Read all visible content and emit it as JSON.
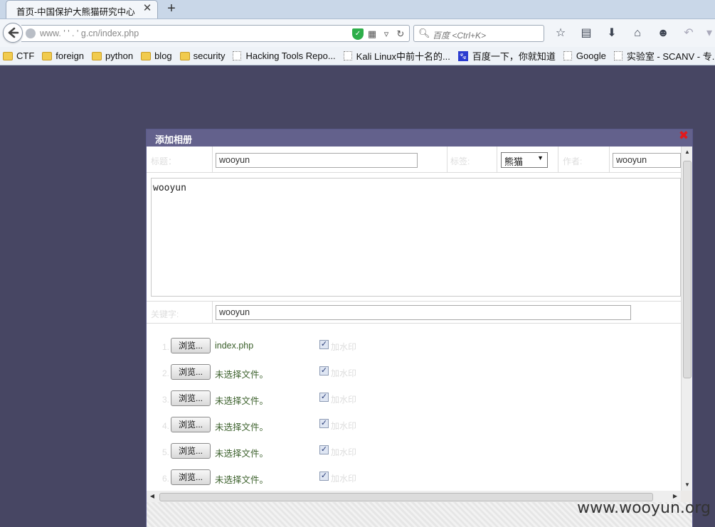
{
  "browser": {
    "tab_title": "首页-中国保护大熊猫研究中心",
    "tab_close": "✕",
    "new_tab": "+",
    "url": "www. '  '   .    '    g.cn/index.php",
    "search_placeholder": "百度 <Ctrl+K>",
    "bookmarks": [
      {
        "label": "CTF",
        "icon": "folder-icon"
      },
      {
        "label": "foreign",
        "icon": "folder-icon"
      },
      {
        "label": "python",
        "icon": "folder-icon"
      },
      {
        "label": "blog",
        "icon": "folder-icon"
      },
      {
        "label": "security",
        "icon": "folder-icon"
      },
      {
        "label": "Hacking Tools Repo...",
        "icon": "page-icon"
      },
      {
        "label": "Kali Linux中前十名的...",
        "icon": "page-icon"
      },
      {
        "label": "百度一下，你就知道",
        "icon": "baidu-paw-icon"
      },
      {
        "label": "Google",
        "icon": "page-icon"
      },
      {
        "label": "实验室 - SCANV - 专...",
        "icon": "page-icon"
      }
    ]
  },
  "dialog": {
    "title": "添加相册",
    "close": "✖",
    "fields": {
      "title_label": "标题：",
      "title_value": "wooyun",
      "tag_label": "标签:",
      "tag_value": "熊猫",
      "author_label": "作者:",
      "author_value": "wooyun",
      "content": "wooyun",
      "keyword_label": "关键字:",
      "keyword_value": "wooyun"
    },
    "files": [
      {
        "num": "1.",
        "button": "浏览...",
        "file": "index.php",
        "watermark": "加水印",
        "checked": "✓"
      },
      {
        "num": "2.",
        "button": "浏览...",
        "file": "未选择文件。",
        "watermark": "加水印",
        "checked": "✓"
      },
      {
        "num": "3.",
        "button": "浏览...",
        "file": "未选择文件。",
        "watermark": "加水印",
        "checked": "✓"
      },
      {
        "num": "4.",
        "button": "浏览...",
        "file": "未选择文件。",
        "watermark": "加水印",
        "checked": "✓"
      },
      {
        "num": "5.",
        "button": "浏览...",
        "file": "未选择文件。",
        "watermark": "加水印",
        "checked": "✓"
      },
      {
        "num": "6.",
        "button": "浏览...",
        "file": "未选择文件。",
        "watermark": "加水印",
        "checked": "✓"
      }
    ]
  },
  "site_watermark": "www.wooyun.org"
}
